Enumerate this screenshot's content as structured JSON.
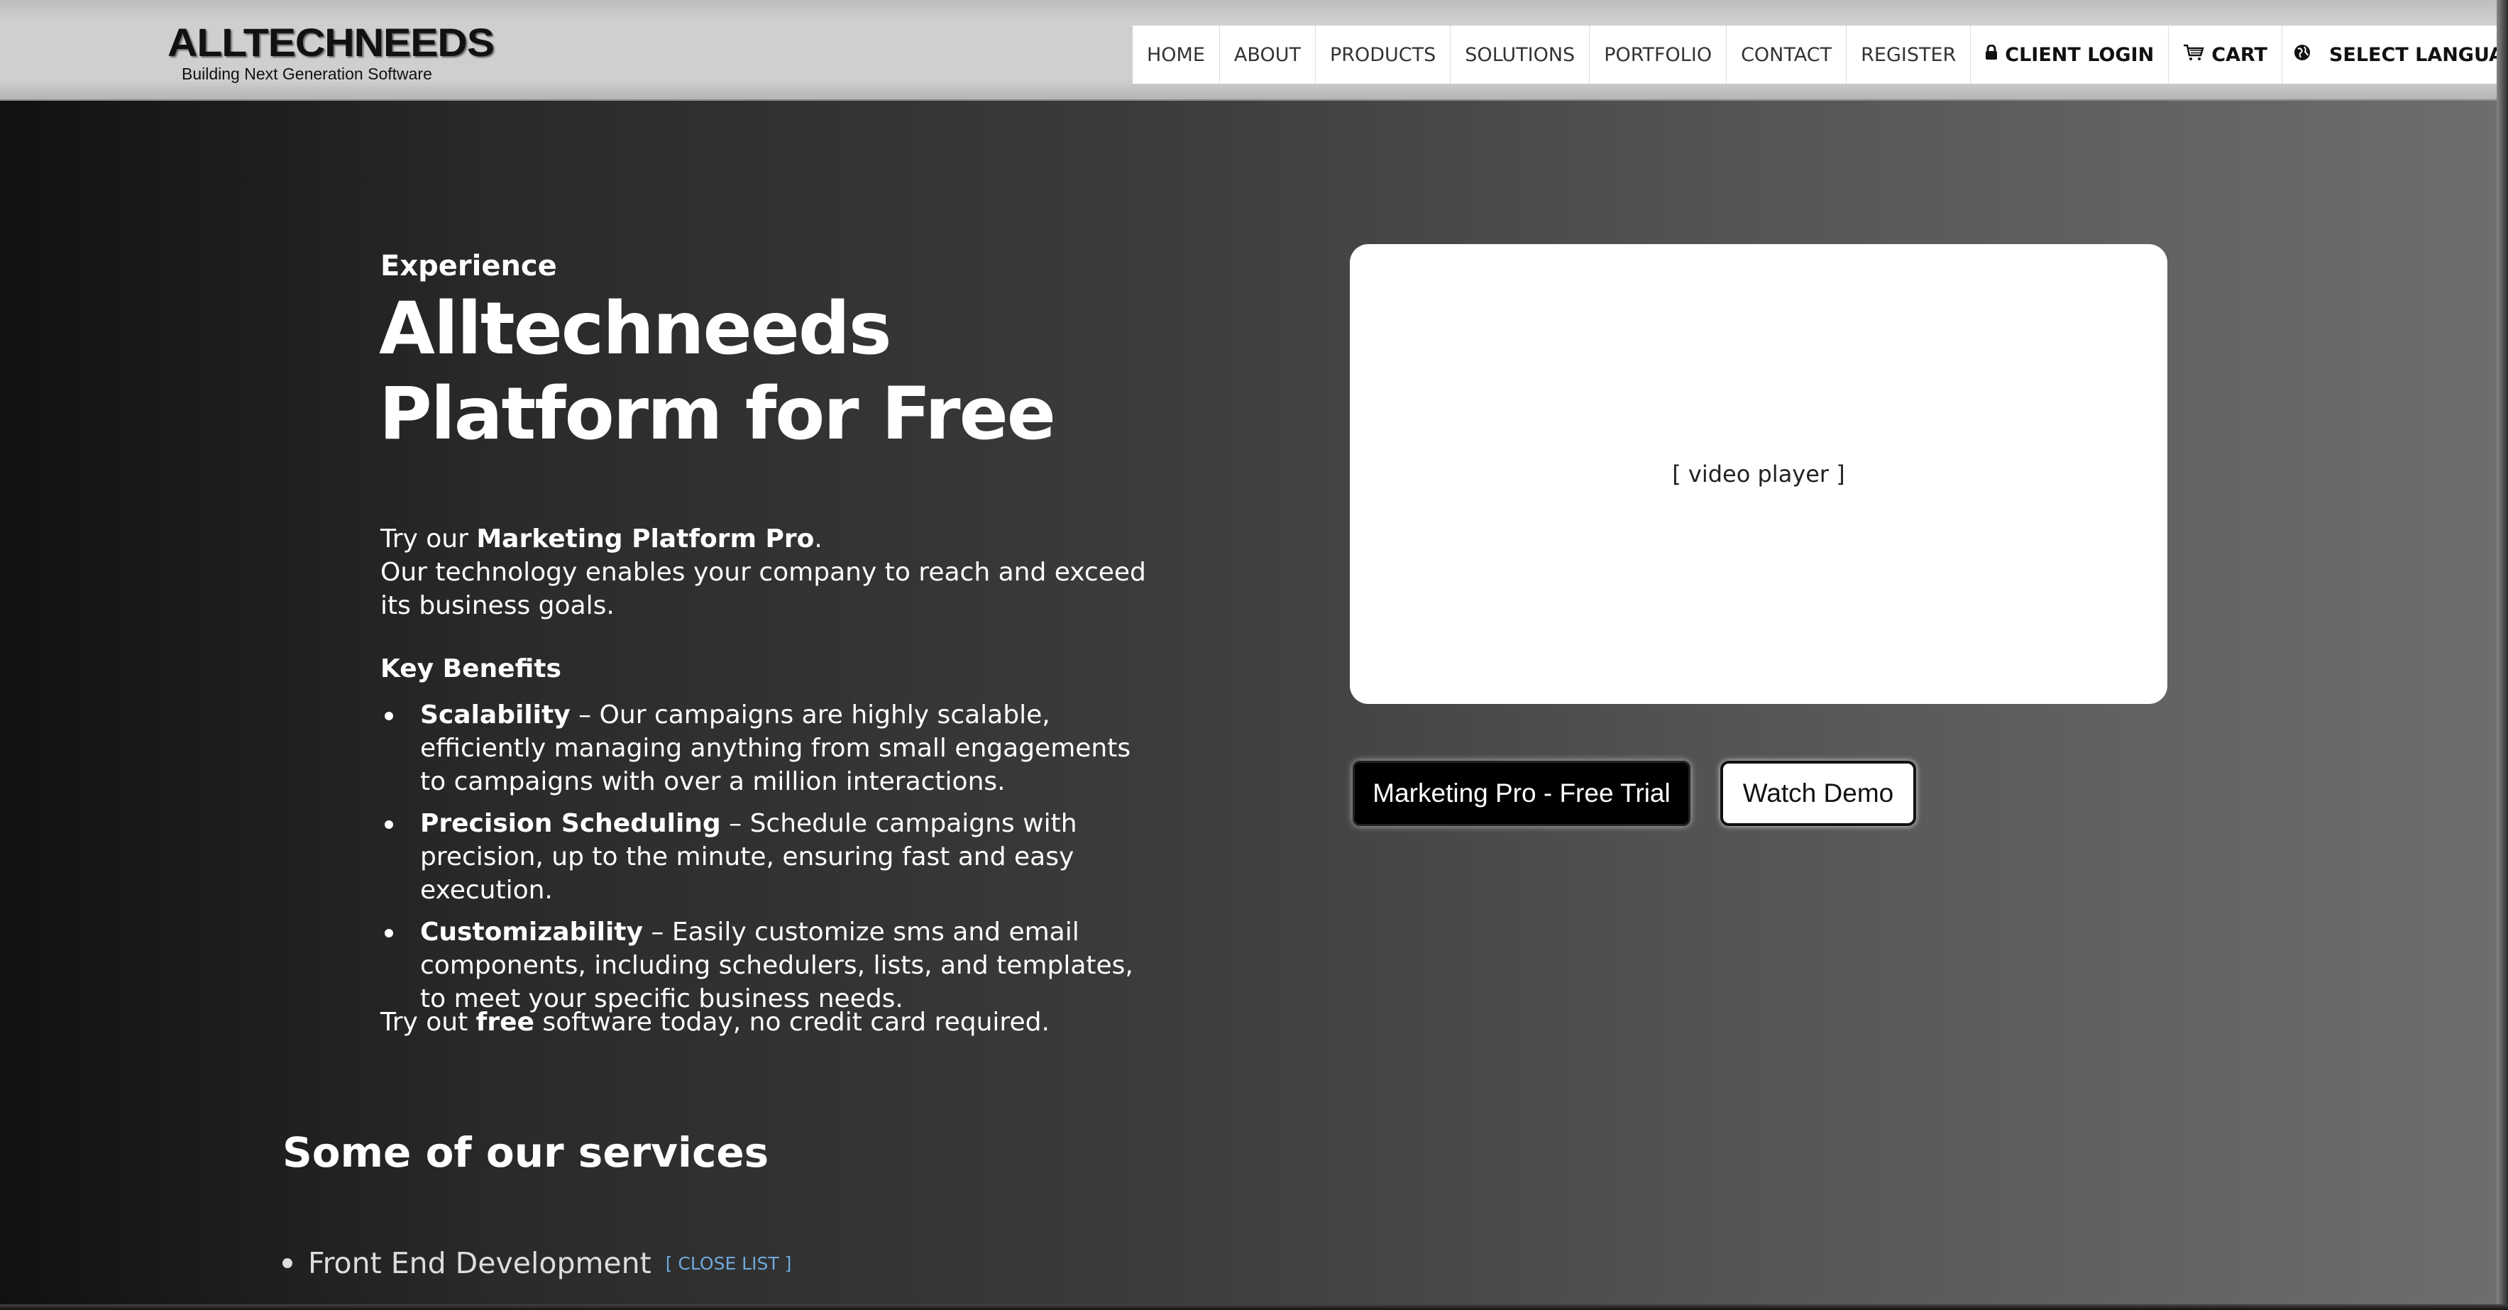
{
  "header": {
    "logo_title": "ALLTECHNEEDS",
    "logo_tagline": "Building Next Generation Software",
    "nav": [
      {
        "label": "HOME"
      },
      {
        "label": "ABOUT"
      },
      {
        "label": "PRODUCTS"
      },
      {
        "label": "SOLUTIONS"
      },
      {
        "label": "PORTFOLIO"
      },
      {
        "label": "CONTACT"
      },
      {
        "label": "REGISTER"
      },
      {
        "label": "CLIENT LOGIN",
        "icon": "lock-icon"
      },
      {
        "label": "CART",
        "icon": "cart-icon"
      },
      {
        "label": "SELECT LANGUAGE",
        "icon": "globe-icon"
      }
    ]
  },
  "hero": {
    "eyebrow": "Experience",
    "headline": "Alltechneeds Platform for Free",
    "intro_prefix": "Try our ",
    "intro_product": "Marketing Platform Pro",
    "intro_suffix": ".",
    "intro_line2": "Our technology enables your company to reach and exceed its business goals.",
    "key_benefits_title": "Key Benefits",
    "benefits": [
      {
        "title": "Scalability",
        "text": " – Our campaigns are highly scalable, efficiently managing anything from small engagements to campaigns with over a million interactions."
      },
      {
        "title": "Precision Scheduling",
        "text": " – Schedule campaigns with precision, up to the minute, ensuring fast and easy execution."
      },
      {
        "title": "Customizability",
        "text": " – Easily customize sms and email components, including schedulers, lists, and templates, to meet your specific business needs."
      }
    ],
    "try_prefix": "Try out ",
    "try_bold": "free",
    "try_suffix": " software today, no credit card required.",
    "video_placeholder": "[ video player ]",
    "primary_button": "Marketing Pro - Free Trial",
    "secondary_button": "Watch Demo"
  },
  "services": {
    "title": "Some of our services",
    "items": [
      {
        "label": "Front End Development",
        "toggle": "[ CLOSE LIST ]"
      }
    ]
  },
  "colors": {
    "link_accent": "#6fa8dc",
    "primary_button_bg": "#000000",
    "secondary_button_bg": "#ffffff"
  }
}
